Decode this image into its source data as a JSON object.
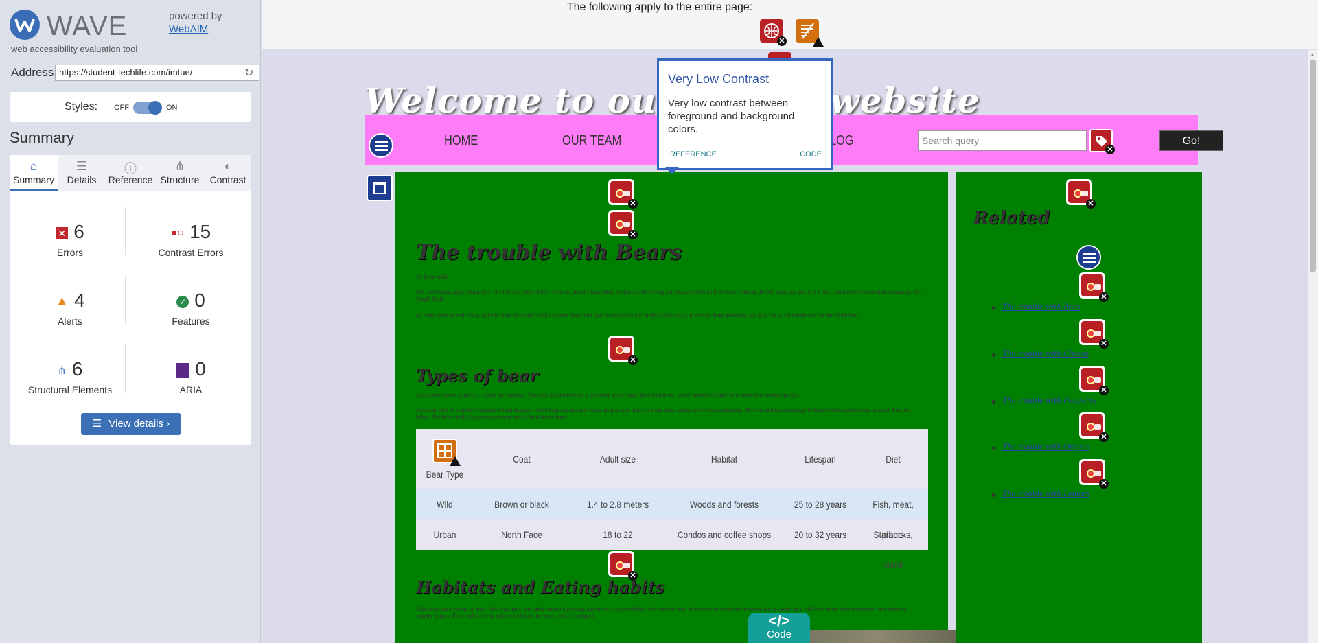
{
  "sidebar": {
    "logo_text": "WAVE",
    "logo_sub": "web accessibility evaluation tool",
    "powered_by": "powered by",
    "webaim": "WebAIM",
    "address_label": "Address:",
    "address_value": "https://student-techlife.com/imtue/",
    "styles_label": "Styles:",
    "styles_off": "OFF",
    "styles_on": "ON",
    "summary_title": "Summary",
    "tabs": [
      {
        "label": "Summary",
        "icon": "home-icon"
      },
      {
        "label": "Details",
        "icon": "list-icon"
      },
      {
        "label": "Reference",
        "icon": "info-icon"
      },
      {
        "label": "Structure",
        "icon": "structure-icon"
      },
      {
        "label": "Contrast",
        "icon": "contrast-icon"
      }
    ],
    "stats": {
      "errors": {
        "num": "6",
        "label": "Errors"
      },
      "contrast_errors": {
        "num": "15",
        "label": "Contrast Errors"
      },
      "alerts": {
        "num": "4",
        "label": "Alerts"
      },
      "features": {
        "num": "0",
        "label": "Features"
      },
      "structural": {
        "num": "6",
        "label": "Structural Elements"
      },
      "aria": {
        "num": "0",
        "label": "ARIA"
      }
    },
    "view_details": "View details ›"
  },
  "topbar": {
    "text": "The following apply to the entire page:"
  },
  "site": {
    "title": "Welcome to our",
    "title_end": "website",
    "nav": [
      "HOME",
      "OUR TEAM",
      "LOG"
    ],
    "search_placeholder": "Search query",
    "go": "Go!",
    "main": {
      "h1": "The trouble with Bears",
      "byline": "By Evan Wild",
      "p1": "Tall, lumbering, angry, dangerous. The real live bears of this world are proud, independent creatures, self-serving and always on the hunt for food. Nothing like the bears you see on TV, like Baloo from renowned documentary, The Jungle Book.",
      "p2": "So what are bears really like, and why does the world's media portray them with such a skewed vision? In this article we try to answer those questions, and give you a real insight into the life of the bear.",
      "h2": "Types of bear",
      "p3": "Bears come in two varieties — large and medium. You don't get small bears. If you have seen a small bear, then it was in fact probably a baby bear (cub) from another species.",
      "p4": "Bears can also be classified in terms of their habitat — both large and medium bears are just as at home in urban areas as they are in the countryside. Different habitats encourage different behaviour however, as you'll find out below. The below table also gives you some useful facts about bears.",
      "table_headers": [
        "Bear Type",
        "Coat",
        "Adult size",
        "Habitat",
        "Lifespan",
        "Diet"
      ],
      "table_rows": [
        [
          "Wild",
          "Brown or black",
          "1.4 to 2.8 meters",
          "Woods and forests",
          "25 to 28 years",
          "Fish, meat, plants"
        ],
        [
          "Urban",
          "North Face",
          "18 to 22",
          "Condos and coffee shops",
          "20 to 32 years",
          "Starbucks, sushi"
        ]
      ],
      "h3": "Habitats and Eating habits",
      "p5": "Wild bears eat a variety of meat, fish, fruit, nuts, and other naturally growing ingredients. In general they will hunt for food themselves in woodland or rivers, but at a push they will track down their sustenance from farms or country houses. They tend to live in relative isolation, in caves, tents, or cottages."
    },
    "related": {
      "title": "Related",
      "links": [
        "The trouble with Bees",
        "The trouble with Cheese",
        "The trouble with Penguins",
        "The trouble with Organs",
        "The trouble with Lemurs"
      ]
    }
  },
  "tooltip": {
    "title": "Very Low Contrast",
    "body": "Very low contrast between foreground and background colors.",
    "reference": "REFERENCE",
    "code": "CODE"
  },
  "code_tab": {
    "symbol": "</>",
    "label": "Code"
  },
  "colors": {
    "accent": "#3b6fb6",
    "error": "#b82026",
    "nav": "#ff7cf8",
    "content_bg": "#008000"
  }
}
